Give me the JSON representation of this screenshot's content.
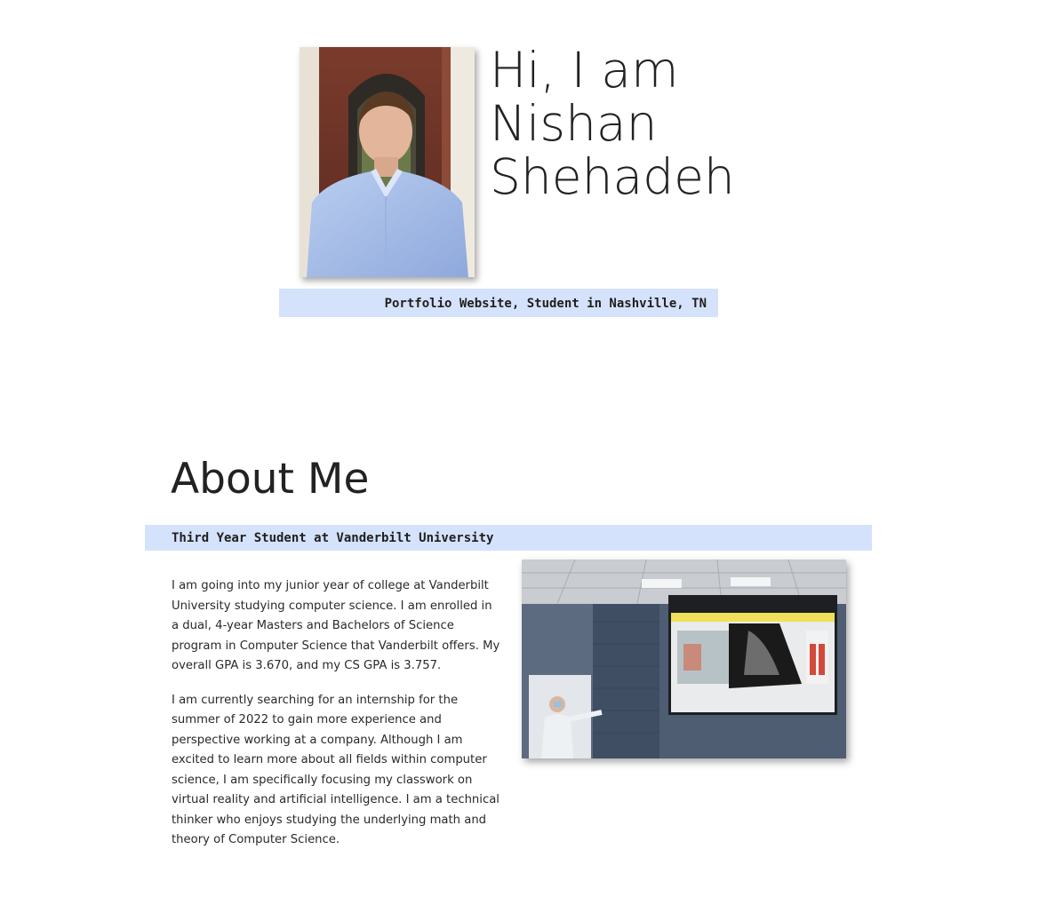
{
  "hero": {
    "greeting": "Hi, I am",
    "first_name": "Nishan",
    "last_name": "Shehadeh",
    "photo_icon": "portrait-photo",
    "subtitle": "Portfolio Website, Student in Nashville, TN"
  },
  "about": {
    "heading": "About Me",
    "band_label": "Third Year Student at Vanderbilt University",
    "paragraphs": [
      "I am going into my junior year of college at Vanderbilt University studying computer science. I am enrolled in a dual, 4-year Masters and Bachelors of Science program in Computer Science that Vanderbilt offers. My overall GPA is 3.670, and my CS GPA is 3.757.",
      "I am currently searching for an internship for the summer of 2022 to gain more experience and perspective working at a company. Although I am excited to learn more about all fields within computer science, I am specifically focusing my classwork on virtual reality and artificial intelligence. I am a technical thinker who enjoys studying the underlying math and theory of Computer Science."
    ],
    "photo_icon": "presentation-photo"
  },
  "colors": {
    "band_background": "#d5e2fb",
    "text": "#222222"
  }
}
